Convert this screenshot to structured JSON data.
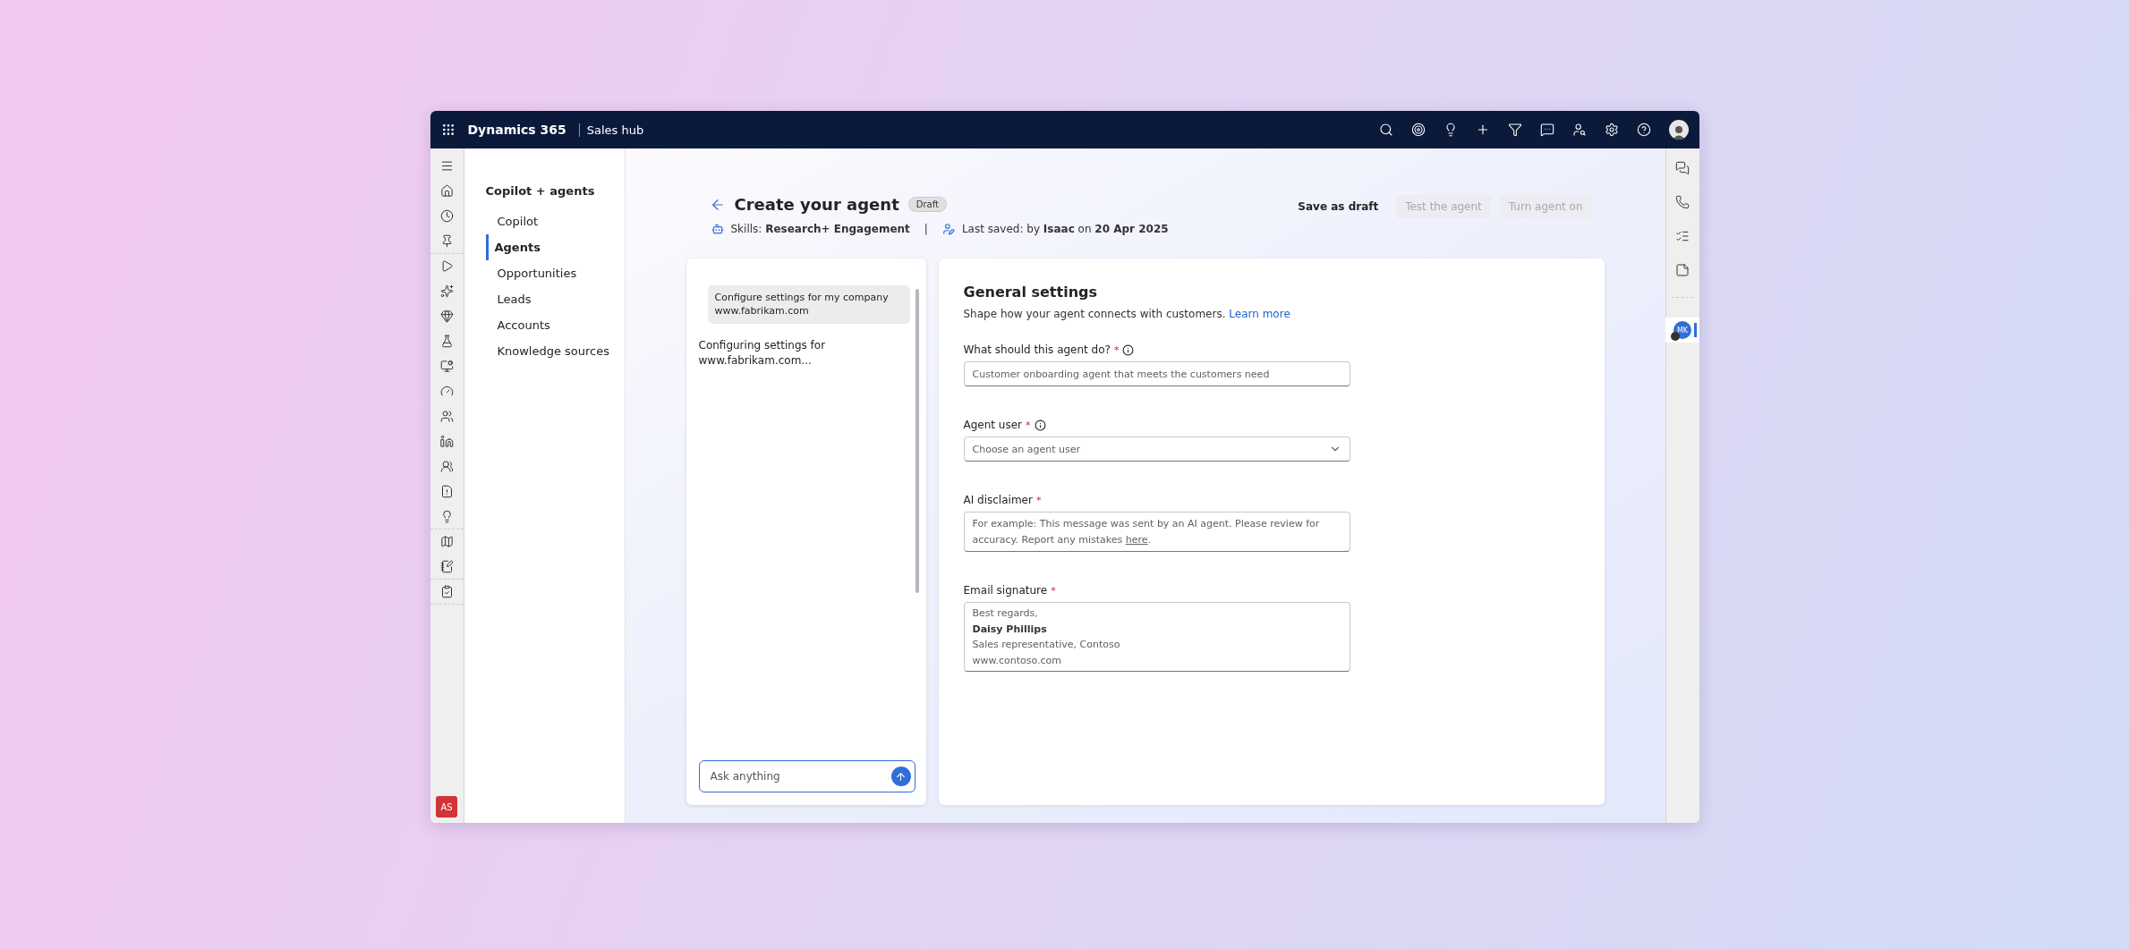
{
  "top_bar": {
    "app_name": "Dynamics 365",
    "area": "Sales hub",
    "actions": [
      {
        "kind": "search"
      },
      {
        "kind": "target"
      },
      {
        "kind": "lightbulb"
      },
      {
        "kind": "plus"
      },
      {
        "kind": "filter"
      },
      {
        "kind": "chat"
      },
      {
        "kind": "assist"
      },
      {
        "kind": "settings"
      },
      {
        "kind": "help"
      },
      {
        "kind": "avatar"
      }
    ]
  },
  "left_rail": {
    "groups": [
      {
        "items": [
          {
            "kind": "menu"
          },
          {
            "kind": "home"
          },
          {
            "kind": "recent"
          },
          {
            "kind": "pin"
          }
        ]
      },
      {
        "items": [
          {
            "kind": "play"
          },
          {
            "kind": "copilot"
          },
          {
            "kind": "gem"
          },
          {
            "kind": "flask"
          },
          {
            "kind": "monitor"
          },
          {
            "kind": "gauge"
          },
          {
            "kind": "people"
          },
          {
            "kind": "linkedin"
          },
          {
            "kind": "teams"
          },
          {
            "kind": "alert"
          },
          {
            "kind": "idea"
          }
        ]
      },
      {
        "items": [
          {
            "kind": "map"
          },
          {
            "kind": "notebook"
          }
        ]
      },
      {
        "items": [
          {
            "kind": "checklist"
          }
        ]
      }
    ],
    "user_initials": "AS"
  },
  "nav": {
    "title": "Copilot + agents",
    "items": [
      {
        "label": "Copilot",
        "selected": false
      },
      {
        "label": "Agents",
        "selected": true
      },
      {
        "label": "Opportunities",
        "selected": false
      },
      {
        "label": "Leads",
        "selected": false
      },
      {
        "label": "Accounts",
        "selected": false
      },
      {
        "label": "Knowledge sources",
        "selected": false
      }
    ]
  },
  "header": {
    "title": "Create your agent",
    "badge": "Draft",
    "skills_label": "Skills:",
    "skills": "Research+ Engagement",
    "separator": "|",
    "saved_label": "Last saved: by",
    "saved_by": "Isaac",
    "saved_on_label": "on",
    "saved_date": "20 Apr 2025",
    "buttons": [
      {
        "label": "Save as draft",
        "disabled": false
      },
      {
        "label": "Test the agent",
        "disabled": true
      },
      {
        "label": "Turn agent on",
        "disabled": true
      }
    ]
  },
  "chat": {
    "messages": [
      {
        "kind": "user",
        "text": "Configure settings for my company www.fabrikam.com"
      },
      {
        "kind": "agent",
        "text": "Configuring settings for www.fabrikam.com..."
      }
    ],
    "input_placeholder": "Ask anything"
  },
  "form": {
    "title": "General settings",
    "subtitle": "Shape how your agent connects with customers.",
    "link": "Learn more",
    "required_mark": "*",
    "fields": [
      {
        "kind": "text",
        "label": "What should this agent do?",
        "required": true,
        "info": true,
        "placeholder": "Customer onboarding agent that meets the customers need"
      },
      {
        "kind": "select",
        "label": "Agent user",
        "required": true,
        "info": true,
        "placeholder": "Choose an agent user"
      },
      {
        "kind": "note",
        "label": "AI disclaimer",
        "required": true,
        "info": false,
        "text": "For example: This message was sent by an AI agent. Please review for accuracy. Report any mistakes",
        "link": "here",
        "after": "."
      },
      {
        "kind": "lines",
        "label": "Email signature",
        "required": true,
        "info": false,
        "lines": [
          {
            "text": "Best regards,",
            "bold": false
          },
          {
            "text": "Daisy Phillips",
            "bold": true
          },
          {
            "text": "Sales representative, Contoso",
            "bold": false
          },
          {
            "text": "www.contoso.com",
            "bold": false
          }
        ]
      }
    ]
  },
  "right_rail": {
    "items": [
      {
        "kind": "chat"
      },
      {
        "kind": "phone"
      },
      {
        "kind": "list"
      },
      {
        "kind": "note"
      }
    ],
    "contact_initials": "MK"
  }
}
